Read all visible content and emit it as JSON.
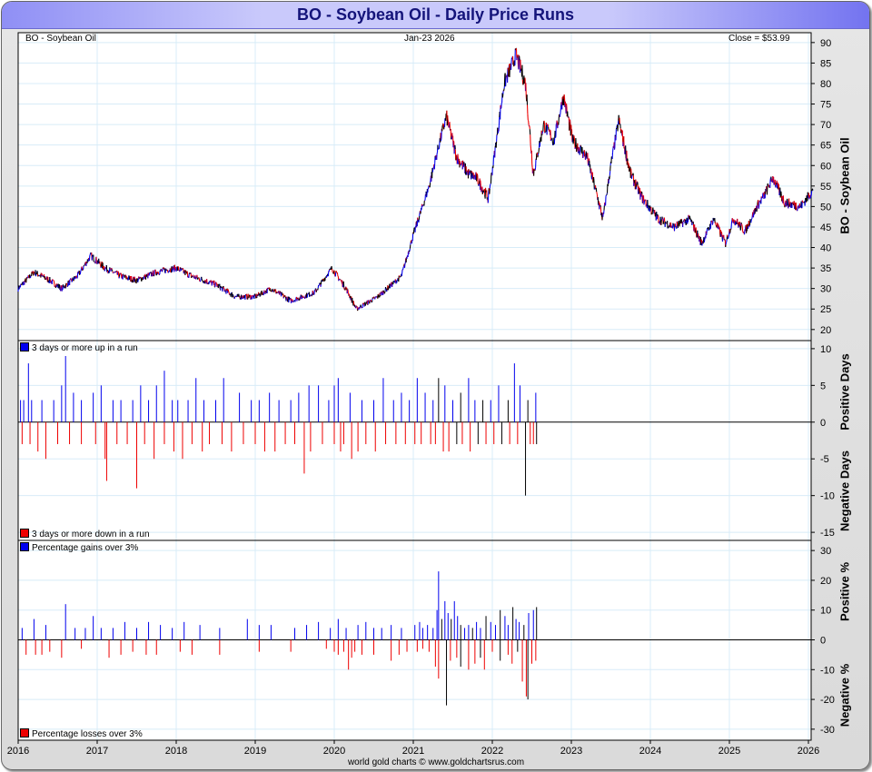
{
  "title": "BO  -  Soybean Oil - Daily Price Runs",
  "header": {
    "symbol": "BO  -  Soybean Oil",
    "date": "Jan-23  2026",
    "close": "Close = $53.99"
  },
  "legends": {
    "up_runs": "3 days or more up in a run",
    "down_runs": "3 days or more down in a run",
    "gains": "Percentage gains over 3%",
    "losses": "Percentage losses over 3%"
  },
  "axis_titles": {
    "price": "BO  -  Soybean Oil",
    "pos_days": "Positive Days",
    "neg_days": "Negative Days",
    "pos_pct": "Positive %",
    "neg_pct": "Negative %"
  },
  "footer": "world gold charts © www.goldchartsrus.com",
  "colors": {
    "up": "#0000ee",
    "down": "#ee0000",
    "grid": "#d8ecf8"
  },
  "chart_data": [
    {
      "type": "line",
      "title": "BO - Soybean Oil",
      "ylabel": "BO - Soybean Oil",
      "ylim": [
        17.3,
        92.4
      ],
      "yticks": [
        20,
        25,
        30,
        35,
        40,
        45,
        50,
        55,
        60,
        65,
        70,
        75,
        80,
        85,
        90
      ],
      "xticks": [
        "2016",
        "2017",
        "2018",
        "2019",
        "2020",
        "2021",
        "2022",
        "2023",
        "2024",
        "2025",
        "2026"
      ],
      "xlim": [
        2016.0,
        2026.05
      ],
      "keyframes": [
        [
          2016.0,
          30
        ],
        [
          2016.2,
          34
        ],
        [
          2016.4,
          32
        ],
        [
          2016.55,
          30
        ],
        [
          2016.75,
          33
        ],
        [
          2016.92,
          38
        ],
        [
          2017.1,
          35
        ],
        [
          2017.3,
          33
        ],
        [
          2017.5,
          32
        ],
        [
          2017.75,
          34
        ],
        [
          2018.0,
          35
        ],
        [
          2018.2,
          33
        ],
        [
          2018.5,
          31
        ],
        [
          2018.75,
          28
        ],
        [
          2019.0,
          28
        ],
        [
          2019.2,
          30
        ],
        [
          2019.45,
          27
        ],
        [
          2019.75,
          29
        ],
        [
          2019.97,
          35
        ],
        [
          2020.15,
          30
        ],
        [
          2020.28,
          25
        ],
        [
          2020.55,
          28
        ],
        [
          2020.85,
          33
        ],
        [
          2021.0,
          43
        ],
        [
          2021.2,
          55
        ],
        [
          2021.35,
          67
        ],
        [
          2021.42,
          72
        ],
        [
          2021.55,
          62
        ],
        [
          2021.7,
          58
        ],
        [
          2021.8,
          57
        ],
        [
          2021.95,
          52
        ],
        [
          2022.08,
          70
        ],
        [
          2022.15,
          80
        ],
        [
          2022.3,
          87
        ],
        [
          2022.42,
          80
        ],
        [
          2022.52,
          58
        ],
        [
          2022.65,
          70
        ],
        [
          2022.78,
          66
        ],
        [
          2022.9,
          77
        ],
        [
          2023.02,
          66
        ],
        [
          2023.2,
          62
        ],
        [
          2023.4,
          47
        ],
        [
          2023.5,
          60
        ],
        [
          2023.6,
          71
        ],
        [
          2023.75,
          58
        ],
        [
          2023.9,
          52
        ],
        [
          2024.1,
          47
        ],
        [
          2024.3,
          45
        ],
        [
          2024.5,
          47
        ],
        [
          2024.65,
          41
        ],
        [
          2024.8,
          47
        ],
        [
          2024.95,
          41
        ],
        [
          2025.05,
          47
        ],
        [
          2025.2,
          44
        ],
        [
          2025.35,
          50
        ],
        [
          2025.45,
          53
        ],
        [
          2025.55,
          57
        ],
        [
          2025.7,
          51
        ],
        [
          2025.9,
          50
        ],
        [
          2026.06,
          54
        ]
      ]
    },
    {
      "type": "bar",
      "title": "Daily Price Runs",
      "ylabel": "Positive Days / Negative Days",
      "ylim": [
        -16.1,
        11.1
      ],
      "yticks": [
        10,
        5,
        0,
        -5,
        -10,
        -15
      ],
      "up": [
        [
          2016.03,
          3
        ],
        [
          2016.07,
          3
        ],
        [
          2016.13,
          8
        ],
        [
          2016.17,
          3
        ],
        [
          2016.3,
          3
        ],
        [
          2016.45,
          3
        ],
        [
          2016.55,
          5
        ],
        [
          2016.6,
          9
        ],
        [
          2016.7,
          4
        ],
        [
          2016.8,
          3
        ],
        [
          2016.95,
          4
        ],
        [
          2017.05,
          5
        ],
        [
          2017.2,
          3
        ],
        [
          2017.3,
          3
        ],
        [
          2017.45,
          3
        ],
        [
          2017.55,
          5
        ],
        [
          2017.65,
          3
        ],
        [
          2017.75,
          5
        ],
        [
          2017.85,
          7
        ],
        [
          2017.95,
          3
        ],
        [
          2018.02,
          3
        ],
        [
          2018.15,
          3
        ],
        [
          2018.25,
          6
        ],
        [
          2018.35,
          3
        ],
        [
          2018.5,
          3
        ],
        [
          2018.6,
          6
        ],
        [
          2018.8,
          4
        ],
        [
          2018.95,
          3
        ],
        [
          2019.05,
          3
        ],
        [
          2019.18,
          4
        ],
        [
          2019.3,
          3
        ],
        [
          2019.45,
          3
        ],
        [
          2019.55,
          4
        ],
        [
          2019.68,
          5
        ],
        [
          2019.8,
          5
        ],
        [
          2019.93,
          3
        ],
        [
          2020.0,
          5
        ],
        [
          2020.05,
          6
        ],
        [
          2020.2,
          4
        ],
        [
          2020.35,
          3
        ],
        [
          2020.5,
          3
        ],
        [
          2020.62,
          6
        ],
        [
          2020.75,
          3
        ],
        [
          2020.85,
          4
        ],
        [
          2020.95,
          3
        ],
        [
          2021.05,
          6
        ],
        [
          2021.15,
          4
        ],
        [
          2021.25,
          3
        ],
        [
          2021.32,
          6
        ],
        [
          2021.4,
          5
        ],
        [
          2021.5,
          3
        ],
        [
          2021.6,
          4
        ],
        [
          2021.7,
          6
        ],
        [
          2021.78,
          3
        ],
        [
          2021.88,
          3
        ],
        [
          2021.98,
          3
        ],
        [
          2022.08,
          5
        ],
        [
          2022.2,
          3
        ],
        [
          2022.28,
          8
        ],
        [
          2022.35,
          5
        ],
        [
          2022.45,
          3
        ],
        [
          2022.55,
          4
        ]
      ],
      "down": [
        [
          2016.05,
          -3
        ],
        [
          2016.15,
          -3
        ],
        [
          2016.25,
          -4
        ],
        [
          2016.35,
          -5
        ],
        [
          2016.5,
          -3
        ],
        [
          2016.65,
          -3
        ],
        [
          2016.8,
          -3
        ],
        [
          2016.98,
          -3
        ],
        [
          2017.1,
          -5
        ],
        [
          2017.12,
          -8
        ],
        [
          2017.25,
          -3
        ],
        [
          2017.38,
          -3
        ],
        [
          2017.5,
          -9
        ],
        [
          2017.6,
          -3
        ],
        [
          2017.72,
          -5
        ],
        [
          2017.85,
          -3
        ],
        [
          2017.97,
          -4
        ],
        [
          2018.08,
          -5
        ],
        [
          2018.2,
          -3
        ],
        [
          2018.33,
          -4
        ],
        [
          2018.42,
          -3
        ],
        [
          2018.58,
          -3
        ],
        [
          2018.7,
          -4
        ],
        [
          2018.85,
          -3
        ],
        [
          2019.0,
          -3
        ],
        [
          2019.12,
          -4
        ],
        [
          2019.25,
          -4
        ],
        [
          2019.38,
          -3
        ],
        [
          2019.5,
          -3
        ],
        [
          2019.62,
          -7
        ],
        [
          2019.7,
          -4
        ],
        [
          2019.85,
          -3
        ],
        [
          2020.0,
          -3
        ],
        [
          2020.08,
          -4
        ],
        [
          2020.12,
          -3
        ],
        [
          2020.22,
          -5
        ],
        [
          2020.3,
          -4
        ],
        [
          2020.4,
          -3
        ],
        [
          2020.52,
          -4
        ],
        [
          2020.65,
          -3
        ],
        [
          2020.78,
          -3
        ],
        [
          2020.9,
          -3
        ],
        [
          2021.02,
          -3
        ],
        [
          2021.1,
          -3
        ],
        [
          2021.22,
          -3
        ],
        [
          2021.28,
          -3
        ],
        [
          2021.38,
          -4
        ],
        [
          2021.45,
          -4
        ],
        [
          2021.55,
          -3
        ],
        [
          2021.62,
          -3
        ],
        [
          2021.72,
          -4
        ],
        [
          2021.82,
          -3
        ],
        [
          2021.92,
          -3
        ],
        [
          2022.02,
          -3
        ],
        [
          2022.12,
          -3
        ],
        [
          2022.22,
          -3
        ],
        [
          2022.32,
          -3
        ],
        [
          2022.42,
          -10
        ],
        [
          2022.48,
          -3
        ],
        [
          2022.52,
          -3
        ],
        [
          2022.56,
          -3
        ]
      ]
    },
    {
      "type": "bar",
      "title": "Percentage moves over 3%",
      "ylabel": "Positive % / Negative %",
      "ylim": [
        -33.7,
        33.4
      ],
      "yticks": [
        30,
        20,
        10,
        0,
        -10,
        -20,
        -30
      ],
      "gains": [
        [
          2016.05,
          4
        ],
        [
          2016.2,
          7
        ],
        [
          2016.35,
          5
        ],
        [
          2016.6,
          12
        ],
        [
          2016.72,
          4
        ],
        [
          2016.85,
          4
        ],
        [
          2016.95,
          8
        ],
        [
          2017.05,
          4
        ],
        [
          2017.2,
          4
        ],
        [
          2017.35,
          6
        ],
        [
          2017.5,
          4
        ],
        [
          2017.65,
          6
        ],
        [
          2017.8,
          5
        ],
        [
          2017.95,
          4
        ],
        [
          2018.1,
          6
        ],
        [
          2018.3,
          5
        ],
        [
          2018.55,
          4
        ],
        [
          2018.9,
          7
        ],
        [
          2019.05,
          5
        ],
        [
          2019.2,
          5
        ],
        [
          2019.5,
          4
        ],
        [
          2019.65,
          5
        ],
        [
          2019.8,
          6
        ],
        [
          2019.95,
          4
        ],
        [
          2020.05,
          7
        ],
        [
          2020.15,
          4
        ],
        [
          2020.3,
          5
        ],
        [
          2020.4,
          6
        ],
        [
          2020.5,
          4
        ],
        [
          2020.6,
          4
        ],
        [
          2020.72,
          5
        ],
        [
          2020.85,
          4
        ],
        [
          2021.02,
          5
        ],
        [
          2021.08,
          6
        ],
        [
          2021.12,
          4
        ],
        [
          2021.18,
          5
        ],
        [
          2021.25,
          4
        ],
        [
          2021.3,
          10
        ],
        [
          2021.32,
          23
        ],
        [
          2021.36,
          7
        ],
        [
          2021.4,
          13
        ],
        [
          2021.44,
          9
        ],
        [
          2021.48,
          7
        ],
        [
          2021.52,
          13
        ],
        [
          2021.56,
          8
        ],
        [
          2021.6,
          5
        ],
        [
          2021.65,
          4
        ],
        [
          2021.7,
          5
        ],
        [
          2021.75,
          4
        ],
        [
          2021.8,
          6
        ],
        [
          2021.85,
          4
        ],
        [
          2021.92,
          8
        ],
        [
          2021.98,
          6
        ],
        [
          2022.04,
          5
        ],
        [
          2022.1,
          10
        ],
        [
          2022.16,
          8
        ],
        [
          2022.2,
          5
        ],
        [
          2022.26,
          11
        ],
        [
          2022.3,
          7
        ],
        [
          2022.34,
          6
        ],
        [
          2022.4,
          5
        ],
        [
          2022.46,
          9
        ],
        [
          2022.52,
          10
        ],
        [
          2022.56,
          11
        ]
      ],
      "losses": [
        [
          2016.1,
          -5
        ],
        [
          2016.22,
          -5
        ],
        [
          2016.3,
          -5
        ],
        [
          2016.4,
          -4
        ],
        [
          2016.55,
          -6
        ],
        [
          2016.8,
          -3
        ],
        [
          2017.15,
          -6
        ],
        [
          2017.3,
          -5
        ],
        [
          2017.45,
          -4
        ],
        [
          2017.62,
          -5
        ],
        [
          2017.75,
          -5
        ],
        [
          2018.05,
          -4
        ],
        [
          2018.2,
          -5
        ],
        [
          2018.55,
          -5
        ],
        [
          2019.05,
          -4
        ],
        [
          2019.45,
          -4
        ],
        [
          2019.9,
          -3
        ],
        [
          2020.0,
          -4
        ],
        [
          2020.05,
          -5
        ],
        [
          2020.12,
          -4
        ],
        [
          2020.18,
          -10
        ],
        [
          2020.22,
          -6
        ],
        [
          2020.26,
          -4
        ],
        [
          2020.35,
          -5
        ],
        [
          2020.5,
          -5
        ],
        [
          2020.72,
          -7
        ],
        [
          2020.82,
          -5
        ],
        [
          2020.92,
          -4
        ],
        [
          2021.05,
          -4
        ],
        [
          2021.12,
          -3
        ],
        [
          2021.2,
          -4
        ],
        [
          2021.28,
          -9
        ],
        [
          2021.32,
          -13
        ],
        [
          2021.42,
          -22
        ],
        [
          2021.47,
          -7
        ],
        [
          2021.55,
          -6
        ],
        [
          2021.6,
          -9
        ],
        [
          2021.7,
          -10
        ],
        [
          2021.78,
          -8
        ],
        [
          2021.85,
          -6
        ],
        [
          2021.9,
          -10
        ],
        [
          2022.0,
          -4
        ],
        [
          2022.1,
          -7
        ],
        [
          2022.2,
          -5
        ],
        [
          2022.25,
          -8
        ],
        [
          2022.32,
          -4
        ],
        [
          2022.38,
          -14
        ],
        [
          2022.43,
          -19
        ],
        [
          2022.45,
          -20
        ],
        [
          2022.5,
          -8
        ],
        [
          2022.55,
          -7
        ]
      ]
    }
  ]
}
